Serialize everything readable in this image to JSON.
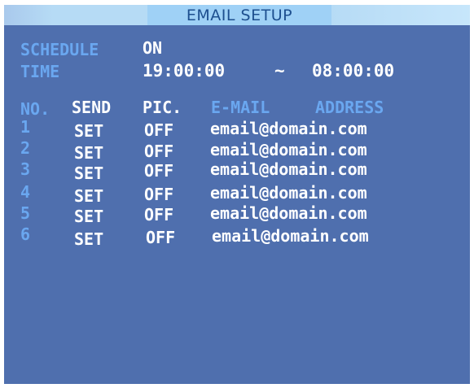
{
  "title": "EMAIL SETUP",
  "schedule": {
    "label": "SCHEDULE",
    "value": "ON"
  },
  "time": {
    "label": "TIME",
    "start": "19:00:00",
    "separator": "~",
    "end": "08:00:00"
  },
  "headers": {
    "no": "NO.",
    "send": "SEND",
    "pic": "PIC.",
    "email": "E-MAIL",
    "address": "ADDRESS"
  },
  "rows": [
    {
      "no": "1",
      "send": "SET",
      "pic": "OFF",
      "email": "email@domain.com"
    },
    {
      "no": "2",
      "send": "SET",
      "pic": "OFF",
      "email": "email@domain.com"
    },
    {
      "no": "3",
      "send": "SET",
      "pic": "OFF",
      "email": "email@domain.com"
    },
    {
      "no": "4",
      "send": "SET",
      "pic": "OFF",
      "email": "email@domain.com"
    },
    {
      "no": "5",
      "send": "SET",
      "pic": "OFF",
      "email": "email@domain.com"
    },
    {
      "no": "6",
      "send": "SET",
      "pic": "OFF",
      "email": "email@domain.com"
    }
  ],
  "colors": {
    "background": "#4f6fae",
    "label": "#6aa7f0",
    "value": "#ffffff",
    "title_bar": "#b6dbf5",
    "title_text": "#1d4f8f"
  }
}
